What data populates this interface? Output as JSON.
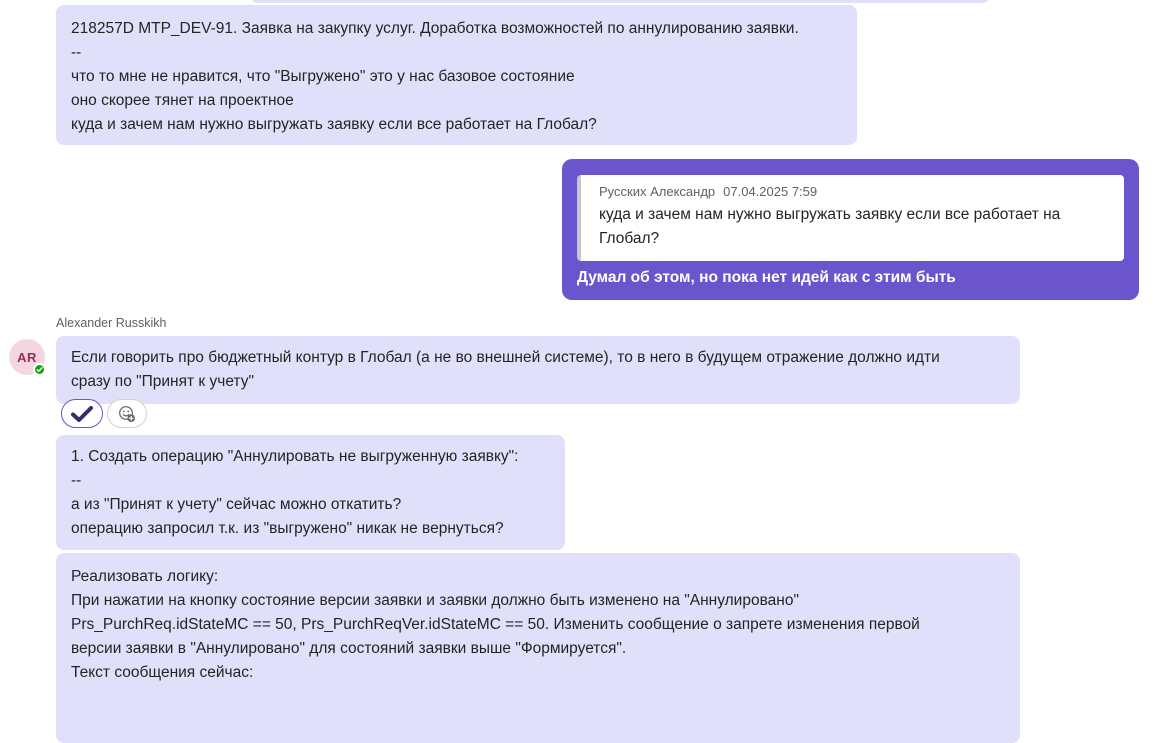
{
  "messages": [
    {
      "lines": [
        "218257D MTP_DEV-91. Заявка на закупку услуг. Доработка возможностей по аннулированию заявки.",
        "--",
        "что то мне не нравится, что \"Выгружено\" это у нас базовое состояние",
        "оно скорее тянет на проектное",
        "куда и зачем нам нужно выгружать заявку если все работает на Глобал?"
      ]
    },
    {
      "quote_author": "Русских Александр",
      "quote_time": "07.04.2025 7:59",
      "quote_lines": [
        "куда и зачем нам нужно выгружать заявку если все работает на",
        "Глобал?"
      ],
      "text": "Думал об этом, но пока нет идей как с этим быть"
    },
    {
      "author": "Alexander Russkikh",
      "avatar_initials": "AR",
      "lines": [
        "Если говорить про бюджетный контур в Глобал (а не во внешней системе), то в него в будущем отражение должно идти",
        "сразу по \"Принят к учету\""
      ]
    },
    {
      "lines": [
        "1. Создать операцию \"Аннулировать не выгруженную заявку\":",
        "--",
        "а из \"Принят к учету\" сейчас можно откатить?",
        "операцию запросил т.к. из \"выгружено\" никак не вернуться?"
      ]
    },
    {
      "lines": [
        "Реализовать логику:",
        "При нажатии на кнопку состояние версии заявки и заявки должно быть изменено на \"Аннулировано\"",
        "Prs_PurchReq.idStateMC == 50, Prs_PurchReqVer.idStateMC == 50. Изменить сообщение о запрете изменения первой",
        "версии заявки в \"Аннулировано\" для состояний заявки выше \"Формируется\".",
        "Текст сообщения сейчас:"
      ]
    }
  ],
  "reactions": {
    "icon": "checkmark-icon",
    "add_icon": "add-reaction-icon"
  },
  "colors": {
    "bubble": "#e0e0fa",
    "mine_bubble": "#6b55cc",
    "presence": "#13a10e",
    "avatar_bg": "#f4d6df"
  }
}
